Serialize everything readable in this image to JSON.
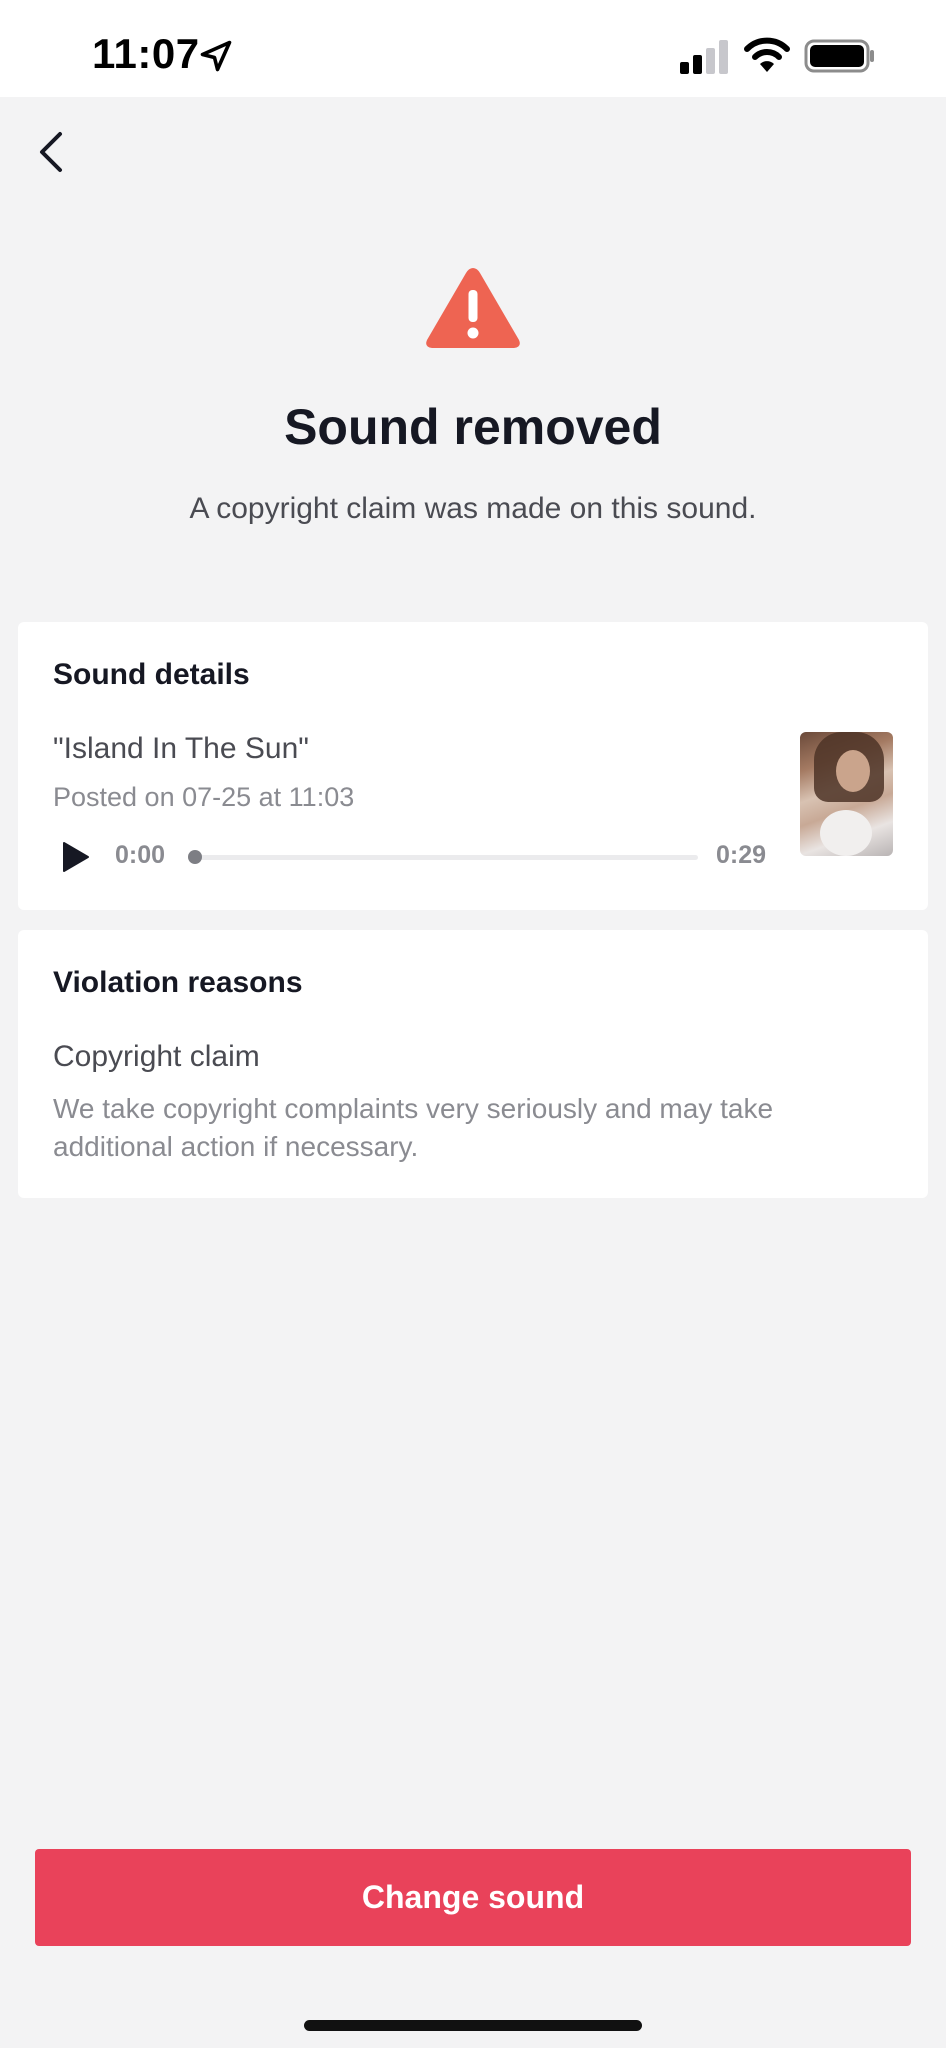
{
  "status_bar": {
    "time": "11:07"
  },
  "icons": {
    "back": "chevron-left-icon",
    "warning": "warning-triangle-icon",
    "play": "play-icon",
    "location": "location-arrow-icon"
  },
  "header": {
    "title": "Sound removed",
    "subtitle": "A copyright claim was made on this sound."
  },
  "sound_details": {
    "heading": "Sound details",
    "name": "\"Island In The Sun\"",
    "posted": "Posted on 07-25 at 11:03",
    "time_start": "0:00",
    "time_end": "0:29",
    "progress": 0
  },
  "violation": {
    "heading": "Violation reasons",
    "reason_title": "Copyright claim",
    "reason_description": "We take copyright complaints very seriously and may take additional action if necessary."
  },
  "actions": {
    "change_sound_label": "Change sound"
  },
  "colors": {
    "accent": "#e9425a",
    "warning": "#ee6452",
    "background": "#f3f3f4"
  }
}
